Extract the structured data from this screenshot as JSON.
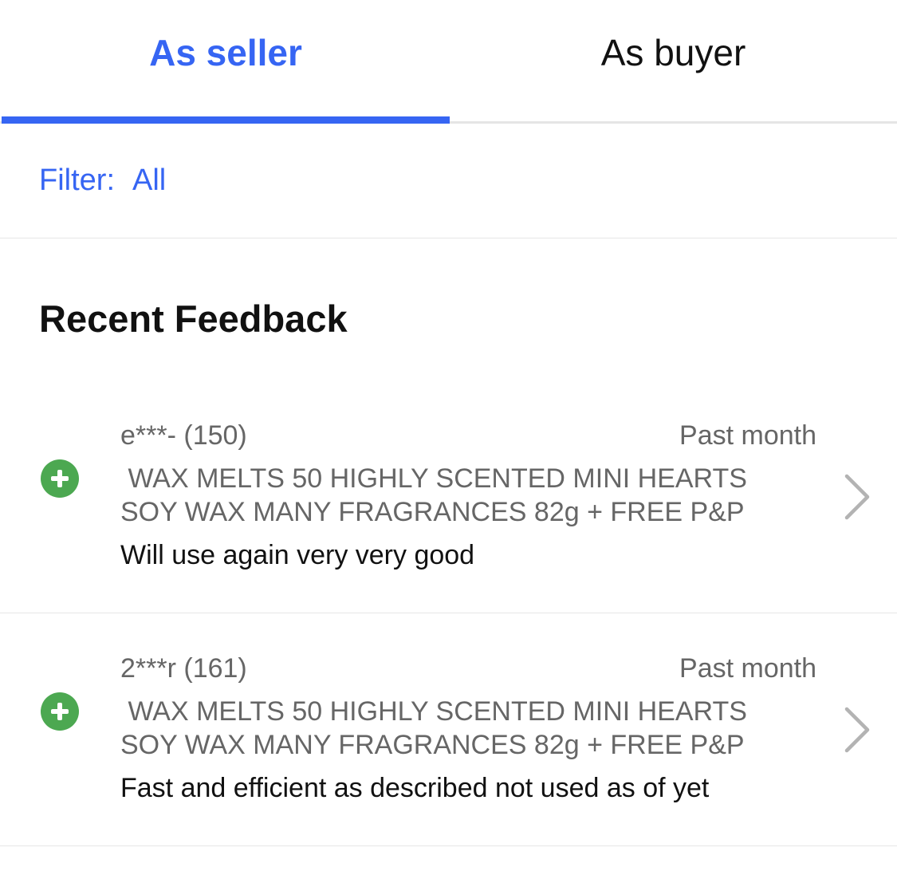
{
  "tabs": {
    "seller_label": "As seller",
    "buyer_label": "As buyer",
    "active": "seller"
  },
  "filter": {
    "label": "Filter:",
    "value": "All"
  },
  "section": {
    "title": "Recent Feedback"
  },
  "feedback": [
    {
      "user": "e***- (150)",
      "time": "Past month",
      "item": " WAX MELTS 50 HIGHLY SCENTED MINI HEARTS\nSOY WAX MANY FRAGRANCES 82g + FREE P&P",
      "comment": "Will use again very very good",
      "rating_icon": "plus-circle-icon"
    },
    {
      "user": "2***r (161)",
      "time": "Past month",
      "item": " WAX MELTS 50 HIGHLY SCENTED MINI HEARTS\nSOY WAX MANY FRAGRANCES 82g + FREE P&P",
      "comment": "Fast and efficient as described not used as of yet",
      "rating_icon": "plus-circle-icon"
    }
  ],
  "colors": {
    "accent": "#3665f3",
    "positive": "#4ca851",
    "secondary_text": "#666666",
    "chevron": "#b3b3b3"
  }
}
